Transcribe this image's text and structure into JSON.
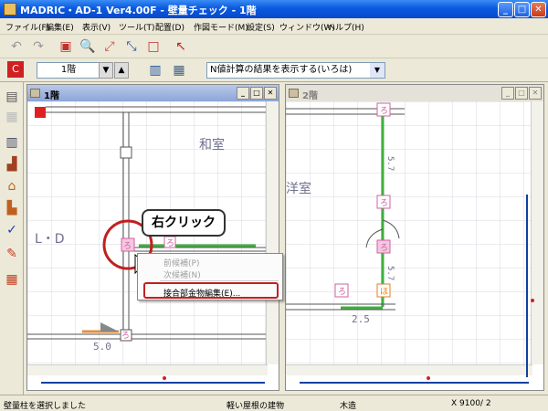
{
  "window": {
    "title": "MADRIC・AD-1 Ver4.00F - 壁量チェック - 1階"
  },
  "menu": [
    "ファイル(F)",
    "編集(E)",
    "表示(V)",
    "ツール(T)",
    "配置(D)",
    "作図モード(M)",
    "設定(S)",
    "ウィンドウ(W)",
    "ヘルプ(H)"
  ],
  "toolbar": {
    "floor": "1階",
    "combo": "N値計算の結果を表示する(いろは)"
  },
  "windows": {
    "left": {
      "title": "1階",
      "rooms": [
        "和室",
        "L・D"
      ],
      "dims": [
        "5.0"
      ],
      "tags": [
        "ろ",
        "ろ",
        "ろ"
      ]
    },
    "right": {
      "title": "2階",
      "rooms": [
        "洋室"
      ],
      "dims": [
        "2.5",
        "5.7",
        "5.7"
      ],
      "tags": [
        "ろ",
        "ろ",
        "ろ",
        "ろ",
        "ほ"
      ]
    }
  },
  "callout": "右クリック",
  "context_menu": {
    "items": [
      "前候補(P)",
      "次候補(N)",
      "接合部金物編集(E)..."
    ]
  },
  "status": {
    "left": "壁量柱を選択しました",
    "mid": "軽い屋根の建物",
    "type": "木造",
    "coord": "X 9100/ 2"
  },
  "colors": {
    "accent": "#c02020",
    "wall": "#40b040",
    "tag": "#d060a0"
  }
}
